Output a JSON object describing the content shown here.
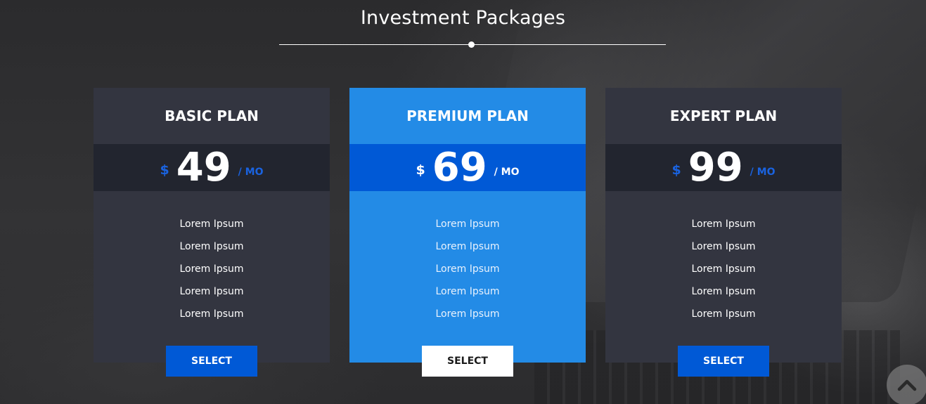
{
  "section": {
    "title": "Investment Packages"
  },
  "plans": [
    {
      "name": "BASIC PLAN",
      "currency": "$",
      "price": "49",
      "period": "/ MO",
      "features": [
        "Lorem Ipsum",
        "Lorem Ipsum",
        "Lorem Ipsum",
        "Lorem Ipsum",
        "Lorem Ipsum"
      ],
      "button_label": "SELECT"
    },
    {
      "name": "PREMIUM PLAN",
      "currency": "$",
      "price": "69",
      "period": "/ MO",
      "features": [
        "Lorem Ipsum",
        "Lorem Ipsum",
        "Lorem Ipsum",
        "Lorem Ipsum",
        "Lorem Ipsum"
      ],
      "button_label": "SELECT"
    },
    {
      "name": "EXPERT PLAN",
      "currency": "$",
      "price": "99",
      "period": "/ MO",
      "features": [
        "Lorem Ipsum",
        "Lorem Ipsum",
        "Lorem Ipsum",
        "Lorem Ipsum",
        "Lorem Ipsum"
      ],
      "button_label": "SELECT"
    }
  ],
  "scroll_top": {
    "icon": "chevron-up-icon"
  },
  "colors": {
    "accent_blue": "#0059d6",
    "premium_blue": "#238be6",
    "card_dark": "#333540",
    "price_band_dark": "#22252f"
  }
}
